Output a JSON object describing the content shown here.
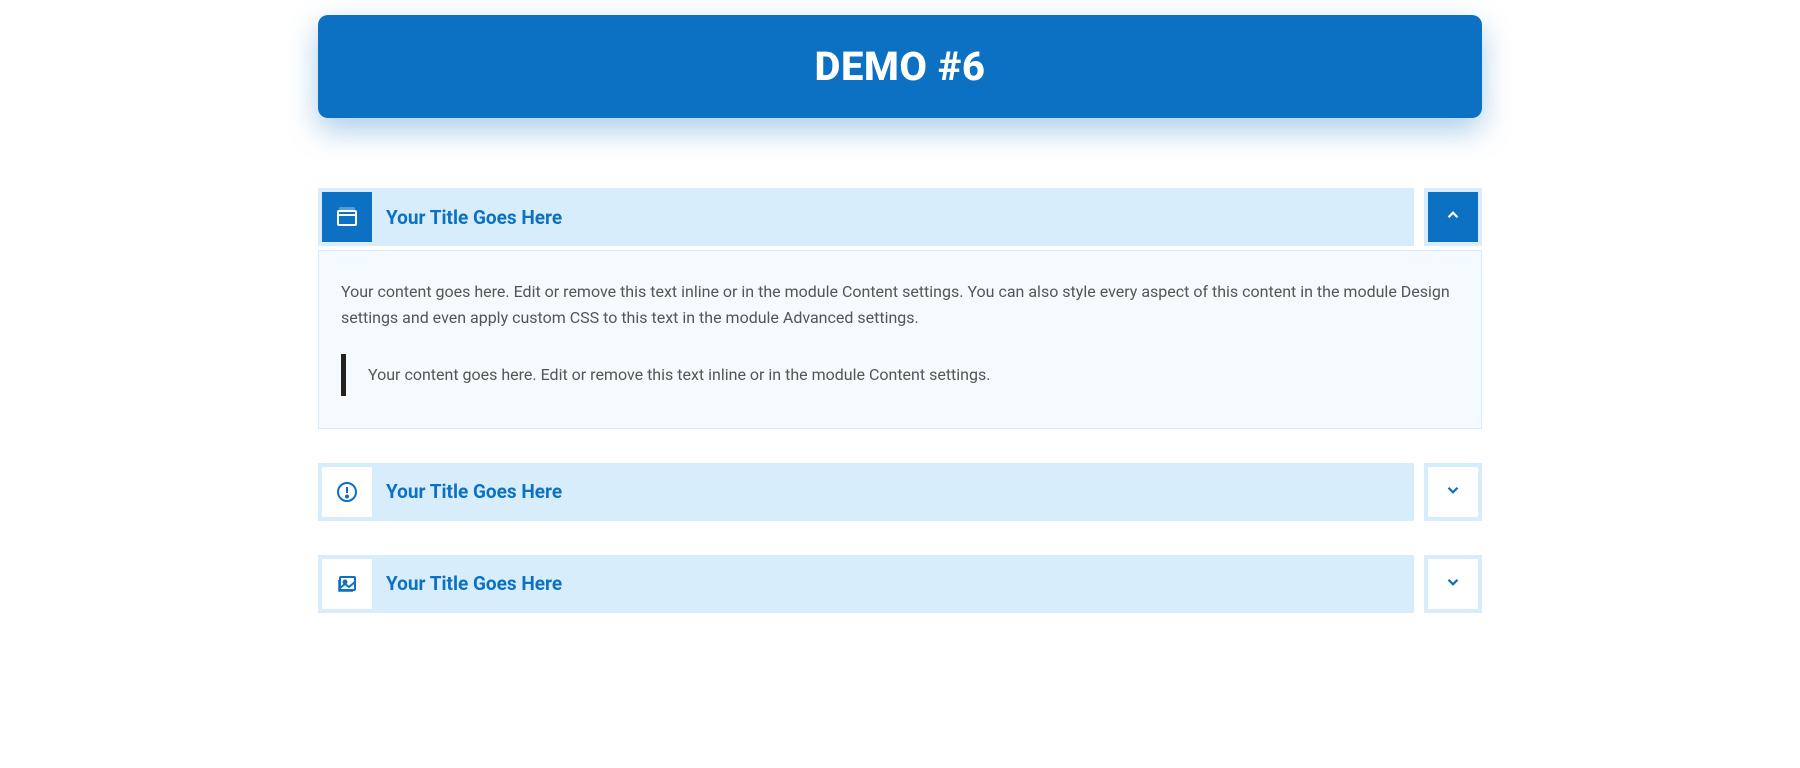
{
  "header": {
    "title": "DEMO #6"
  },
  "accordions": [
    {
      "icon": "window-icon",
      "title": "Your Title Goes Here",
      "expanded": true,
      "content": {
        "paragraph": "Your content goes here. Edit or remove this text inline or in the module Content settings. You can also style every aspect of this content in the module Design settings and even apply custom CSS to this text in the module Advanced settings.",
        "blockquote": "Your content goes here. Edit or remove this text inline or in the module Content settings."
      }
    },
    {
      "icon": "alert-icon",
      "title": "Your Title Goes Here",
      "expanded": false
    },
    {
      "icon": "image-icon",
      "title": "Your Title Goes Here",
      "expanded": false
    }
  ]
}
